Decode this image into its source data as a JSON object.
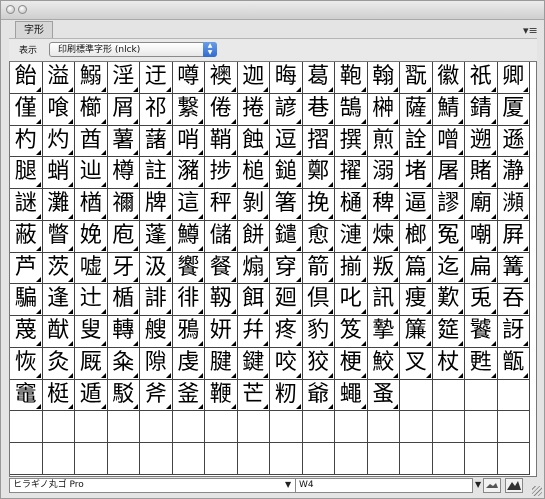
{
  "panel": {
    "tab_title": "字形",
    "show_label": "表示",
    "show_select_value": "印刷標準字形 (nlck)",
    "panel_menu_icon": "panel-menu-icon"
  },
  "glyph_rows": [
    [
      "飴",
      "溢",
      "鰯",
      "淫",
      "迂",
      "噂",
      "襖",
      "迦",
      "晦",
      "葛",
      "鞄",
      "翰",
      "翫",
      "徽",
      "祇",
      "卿"
    ],
    [
      "僅",
      "喰",
      "櫛",
      "屑",
      "祁",
      "繋",
      "倦",
      "捲",
      "諺",
      "巷",
      "鵠",
      "榊",
      "薩",
      "鯖",
      "錆",
      "厦"
    ],
    [
      "杓",
      "灼",
      "酋",
      "薯",
      "藷",
      "哨",
      "鞘",
      "蝕",
      "逗",
      "摺",
      "撰",
      "煎",
      "詮",
      "噌",
      "遡",
      "遜"
    ],
    [
      "腿",
      "蛸",
      "辿",
      "樽",
      "註",
      "瀦",
      "捗",
      "槌",
      "鎚",
      "鄭",
      "擢",
      "溺",
      "堵",
      "屠",
      "賭",
      "瀞"
    ],
    [
      "謎",
      "灘",
      "楢",
      "禰",
      "牌",
      "這",
      "秤",
      "剝",
      "箸",
      "挽",
      "樋",
      "稗",
      "逼",
      "謬",
      "廟",
      "瀕"
    ],
    [
      "蔽",
      "瞥",
      "娩",
      "庖",
      "蓬",
      "鱒",
      "儲",
      "餅",
      "鑓",
      "愈",
      "漣",
      "煉",
      "榔",
      "冤",
      "嘲",
      "屛"
    ],
    [
      "芦",
      "茨",
      "嘘",
      "牙",
      "汲",
      "饗",
      "餐",
      "煽",
      "穿",
      "箭",
      "揃",
      "叛",
      "篇",
      "迄",
      "扁",
      "篝"
    ],
    [
      "騙",
      "逢",
      "辻",
      "楯",
      "誹",
      "徘",
      "靱",
      "餌",
      "廻",
      "倶",
      "叱",
      "訊",
      "痩",
      "歎",
      "兎",
      "吞"
    ],
    [
      "蔑",
      "猷",
      "叟",
      "轉",
      "艘",
      "鴉",
      "妍",
      "幷",
      "疼",
      "豹",
      "笈",
      "摯",
      "簾",
      "筵",
      "饕",
      "訝"
    ],
    [
      "恢",
      "灸",
      "厩",
      "粂",
      "隙",
      "虔",
      "腱",
      "鍵",
      "咬",
      "狡",
      "梗",
      "鮫",
      "叉",
      "杖",
      "甦",
      "甑"
    ],
    [
      "竈",
      "梃",
      "遁",
      "駁",
      "斧",
      "釜",
      "鞭",
      "芒",
      "籾",
      "爺",
      "蠅",
      "蚤",
      "",
      "",
      "",
      ""
    ],
    [
      "",
      "",
      "",
      "",
      "",
      "",
      "",
      "",
      "",
      "",
      "",
      "",
      "",
      "",
      "",
      ""
    ],
    [
      "",
      "",
      "",
      "",
      "",
      "",
      "",
      "",
      "",
      "",
      "",
      "",
      "",
      "",
      "",
      ""
    ]
  ],
  "footer": {
    "font_family_value": "ヒラギノ丸ゴ Pro",
    "font_style_value": "W4",
    "zoom_out_icon": "small-mountain-icon",
    "zoom_in_icon": "large-mountain-icon"
  }
}
